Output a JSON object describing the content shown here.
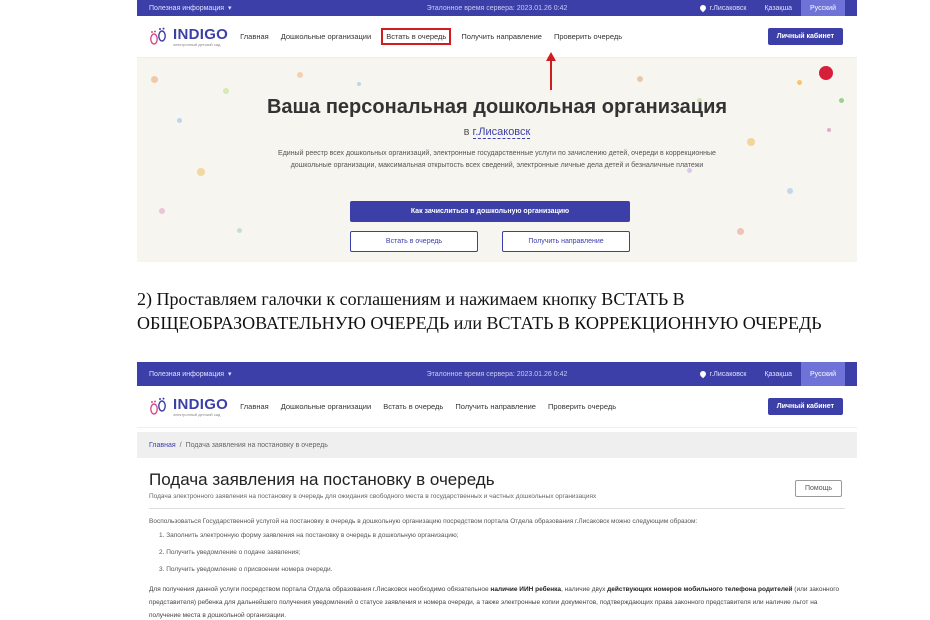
{
  "site": {
    "topbar_info": "Полезная информация",
    "topbar_info_caret": "▾",
    "server_time": "Эталонное время сервера: 2023.01.26 0:42",
    "city": "г.Лисаковск",
    "lang_kz": "Қазақша",
    "lang_ru": "Русский",
    "brand": "INDIGO",
    "brand_sub": "электронный детский сад",
    "nav": [
      "Главная",
      "Дошкольные организации",
      "Встать в очередь",
      "Получить направление",
      "Проверить очередь"
    ],
    "cabinet": "Личный кабинет"
  },
  "hero": {
    "title": "Ваша персональная дошкольная организация",
    "city_prefix": "в",
    "city": "г.Лисаковск",
    "description": "Единый реестр всех дошкольных организаций, электронные государственные услуги по зачислению детей, очереди в коррекционные дошкольные организации, максимальная открытость всех сведений, электронные личные дела детей и безналичные платежи",
    "cta_main": "Как зачислиться в дошкольную организацию",
    "cta_queue": "Встать в очередь",
    "cta_direction": "Получить направление"
  },
  "instruction": "2) Проставляем галочки к соглашениям и нажимаем кнопку ВСТАТЬ В ОБЩЕОБРАЗОВАТЕЛЬНУЮ ОЧЕРЕДЬ или ВСТАТЬ В КОРРЕКЦИОННУЮ ОЧЕРЕДЬ",
  "page2": {
    "crumb_home": "Главная",
    "crumb_sep": "/",
    "crumb_current": "Подача заявления на постановку в очередь",
    "title": "Подача заявления на постановку в очередь",
    "subtitle": "Подача электронного заявления на постановку в очередь для ожидания свободного места в государственных и частных дошкольных организациях",
    "help": "Помощь",
    "intro": "Воспользоваться Государственной услугой на постановку в очередь в дошкольную организацию посредством портала Отдела образования г.Лисаковск можно следующим образом:",
    "steps": [
      "1. Заполнить электронную форму заявления на постановку в очередь в дошкольную организацию;",
      "2. Получить уведомление о подаче заявления;",
      "3. Получить уведомление о присвоении номера очереди."
    ],
    "para_a": "Для получения данной услуги посредством портала Отдела образования г.Лисаковск необходимо обязательное ",
    "para_b": "наличие ИИН ребенка",
    "para_c": ", наличие двух ",
    "para_d": "действующих номеров мобильного телефона родителей",
    "para_e": " (или законного представителя) ребенка для дальнейшего получения уведомлений о статусе заявления и номера очереди, а также электронные копии документов, подтверждающих права",
    "para_f": "законного представителя или наличие льгот на получение места в дошкольной организации."
  }
}
